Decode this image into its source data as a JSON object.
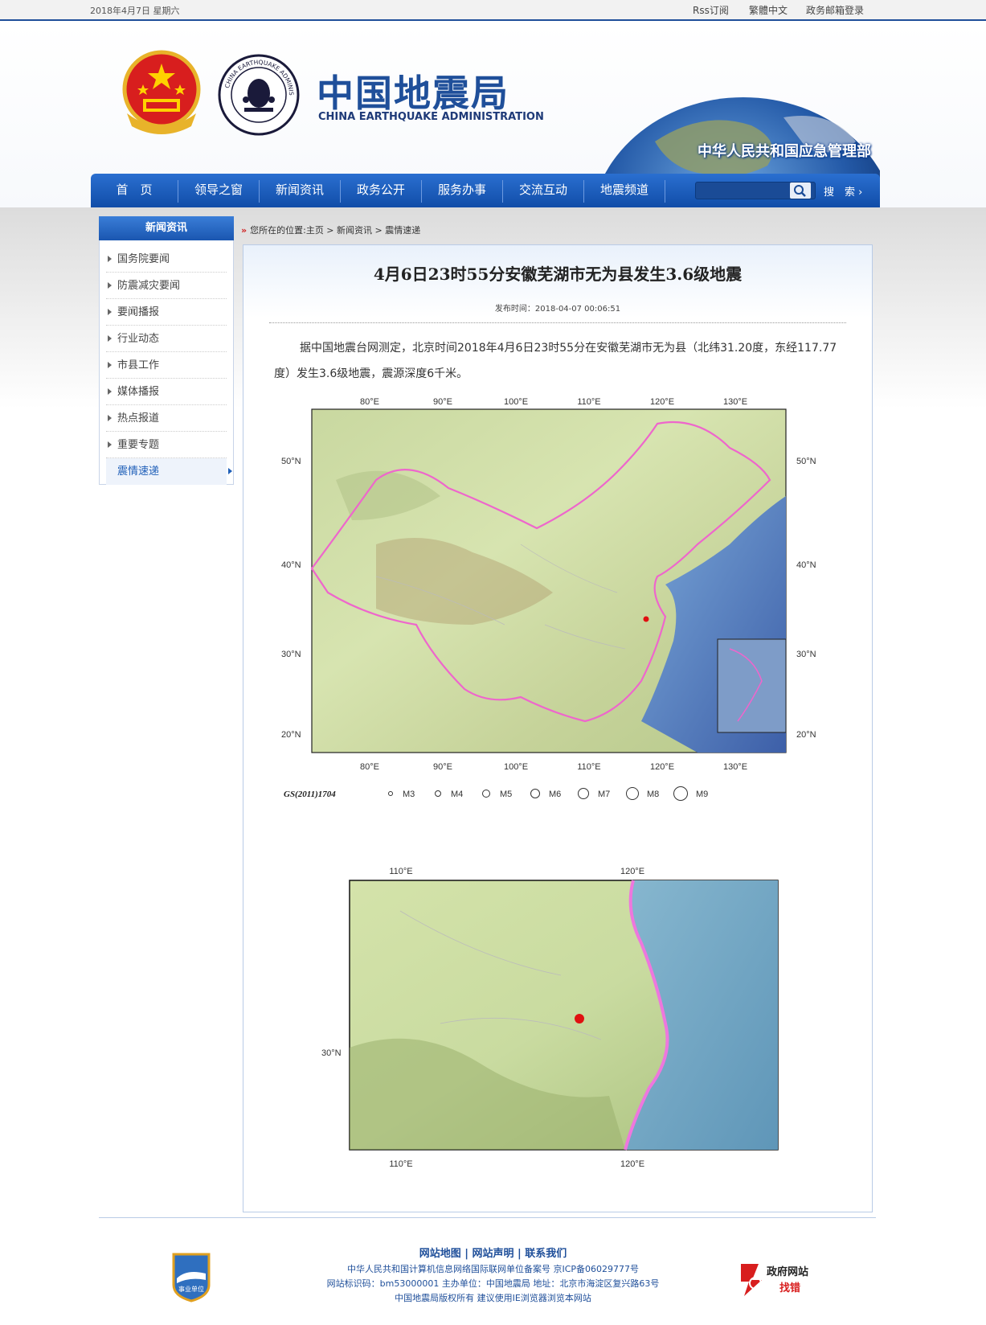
{
  "topbar": {
    "date": "2018年4月7日  星期六",
    "rss": "Rss订阅",
    "traditional": "繁體中文",
    "mail_login": "政务邮箱登录"
  },
  "header": {
    "logo_cn": "中国地震局",
    "logo_en": "CHINA EARTHQUAKE ADMINISTRATION",
    "ministry": "中华人民共和国应急管理部"
  },
  "nav": {
    "items": [
      "首　页",
      "领导之窗",
      "新闻资讯",
      "政务公开",
      "服务办事",
      "交流互动",
      "地震频道"
    ],
    "search_placeholder": "",
    "search_label": "搜　索 ›"
  },
  "sidebar": {
    "title": "新闻资讯",
    "items": [
      "国务院要闻",
      "防震减灾要闻",
      "要闻播报",
      "行业动态",
      "市县工作",
      "媒体播报",
      "热点报道",
      "重要专题",
      "震情速递"
    ],
    "active_index": 8
  },
  "breadcrumb": {
    "mark": "»",
    "text": "您所在的位置:主页 > 新闻资讯 > 震情速递"
  },
  "article": {
    "title": "4月6日23时55分安徽芜湖市无为县发生3.6级地震",
    "pubtime": "发布时间：2018-04-07 00:06:51",
    "body": "据中国地震台网测定，北京时间2018年4月6日23时55分在安徽芜湖市无为县（北纬31.20度，东经117.77度）发生3.6级地震，震源深度6千米。"
  },
  "map1": {
    "x_ticks": [
      "80°E",
      "90°E",
      "100°E",
      "110°E",
      "120°E",
      "130°E"
    ],
    "y_ticks": [
      "50°N",
      "40°N",
      "30°N",
      "20°N"
    ],
    "gs_code": "GS(2011)1704",
    "legend": [
      "M3",
      "M4",
      "M5",
      "M6",
      "M7",
      "M8",
      "M9"
    ]
  },
  "map2": {
    "x_ticks": [
      "110°E",
      "120°E"
    ],
    "y_ticks": [
      "30°N"
    ]
  },
  "footer": {
    "links": "网站地图 | 网站声明 | 联系我们",
    "line1": "中华人民共和国计算机信息网络国际联网单位备案号  京ICP备06029777号",
    "line2": "网站标识码：bm53000001  主办单位：中国地震局  地址：北京市海淀区复兴路63号",
    "line3": "中国地震局版权所有  建议使用IE浏览器浏览本网站",
    "badge_text": "事业单位",
    "gov_site": "政府网站",
    "find_error": "找错"
  },
  "colors": {
    "brand_blue": "#1f4f9a",
    "nav_blue": "#1a5cbf",
    "epicenter_red": "#e01010",
    "border_pink": "#ee66cc"
  }
}
